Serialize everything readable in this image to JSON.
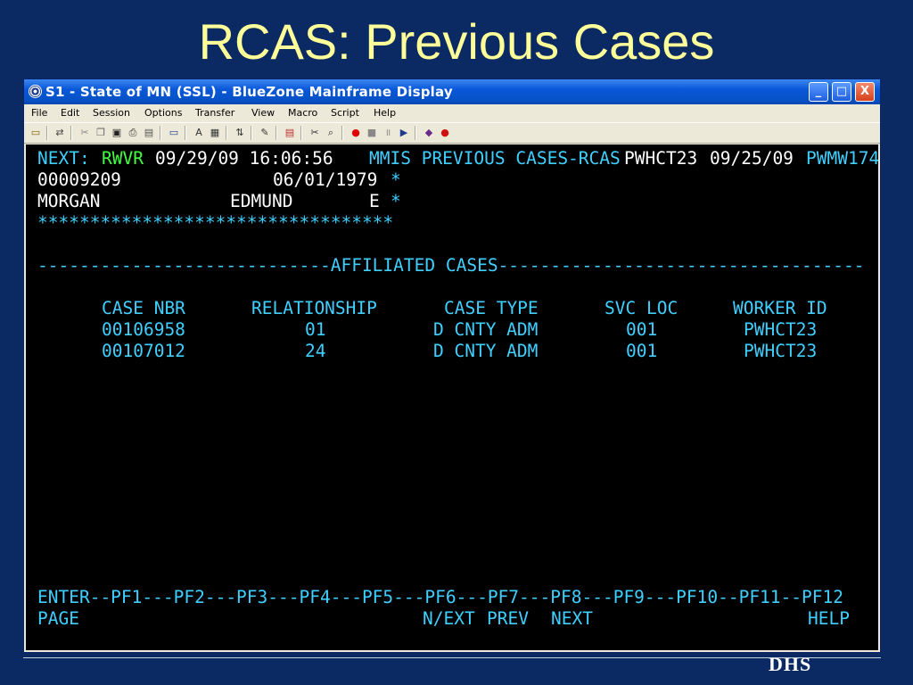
{
  "slide": {
    "title": "RCAS: Previous Cases"
  },
  "window": {
    "title": "S1 - State of MN (SSL) - BlueZone Mainframe Display",
    "controls": {
      "minimize": "_",
      "maximize": "□",
      "close": "X"
    }
  },
  "menu": [
    "File",
    "Edit",
    "Session",
    "Options",
    "Transfer",
    "View",
    "Macro",
    "Script",
    "Help"
  ],
  "toolbar": {
    "icons": [
      "print-icon",
      "send-icon",
      "cut-icon",
      "copy-icon",
      "paste-icon",
      "print-screen-icon",
      "clipboard-icon",
      "display-icon",
      "font-icon",
      "keyboard-icon",
      "transfer-icon",
      "edit-icon",
      "pf-keys-icon",
      "scissors-icon",
      "find-icon",
      "record-icon",
      "stop-icon",
      "pause-icon",
      "play-icon",
      "book-icon",
      "apple-icon"
    ]
  },
  "terminal": {
    "header": {
      "next_label": "NEXT:",
      "next_value": "RWVR",
      "timestamp": "09/29/09 16:06:56",
      "screen_name": "MMIS PREVIOUS CASES-RCAS",
      "user_id": "PWHCT23",
      "date": "09/25/09",
      "screen_id": "PWMW174"
    },
    "person": {
      "id": "00009209",
      "birth_date": "06/01/1979",
      "last_name": "MORGAN",
      "first_name": "EDMUND",
      "middle_initial": "E",
      "marker": "*"
    },
    "stars": "**********************************",
    "section_title": "----------------------------AFFILIATED CASES-----------------------------------",
    "columns": [
      "CASE NBR",
      "RELATIONSHIP",
      "CASE TYPE",
      "SVC LOC",
      "WORKER ID"
    ],
    "rows": [
      [
        "00106958",
        "01",
        "D CNTY ADM",
        "001",
        "PWHCT23"
      ],
      [
        "00107012",
        "24",
        "D CNTY ADM",
        "001",
        "PWHCT23"
      ]
    ],
    "pf_line": "ENTER--PF1---PF2---PF3---PF4---PF5---PF6---PF7---PF8---PF9---PF10--PF11--PF12",
    "pf_labels": {
      "enter": "PAGE",
      "pf6": "N/EXT",
      "pf7": "PREV",
      "pf8": "NEXT",
      "pf12": "HELP"
    }
  },
  "footer": {
    "logo_text": "DHS"
  }
}
